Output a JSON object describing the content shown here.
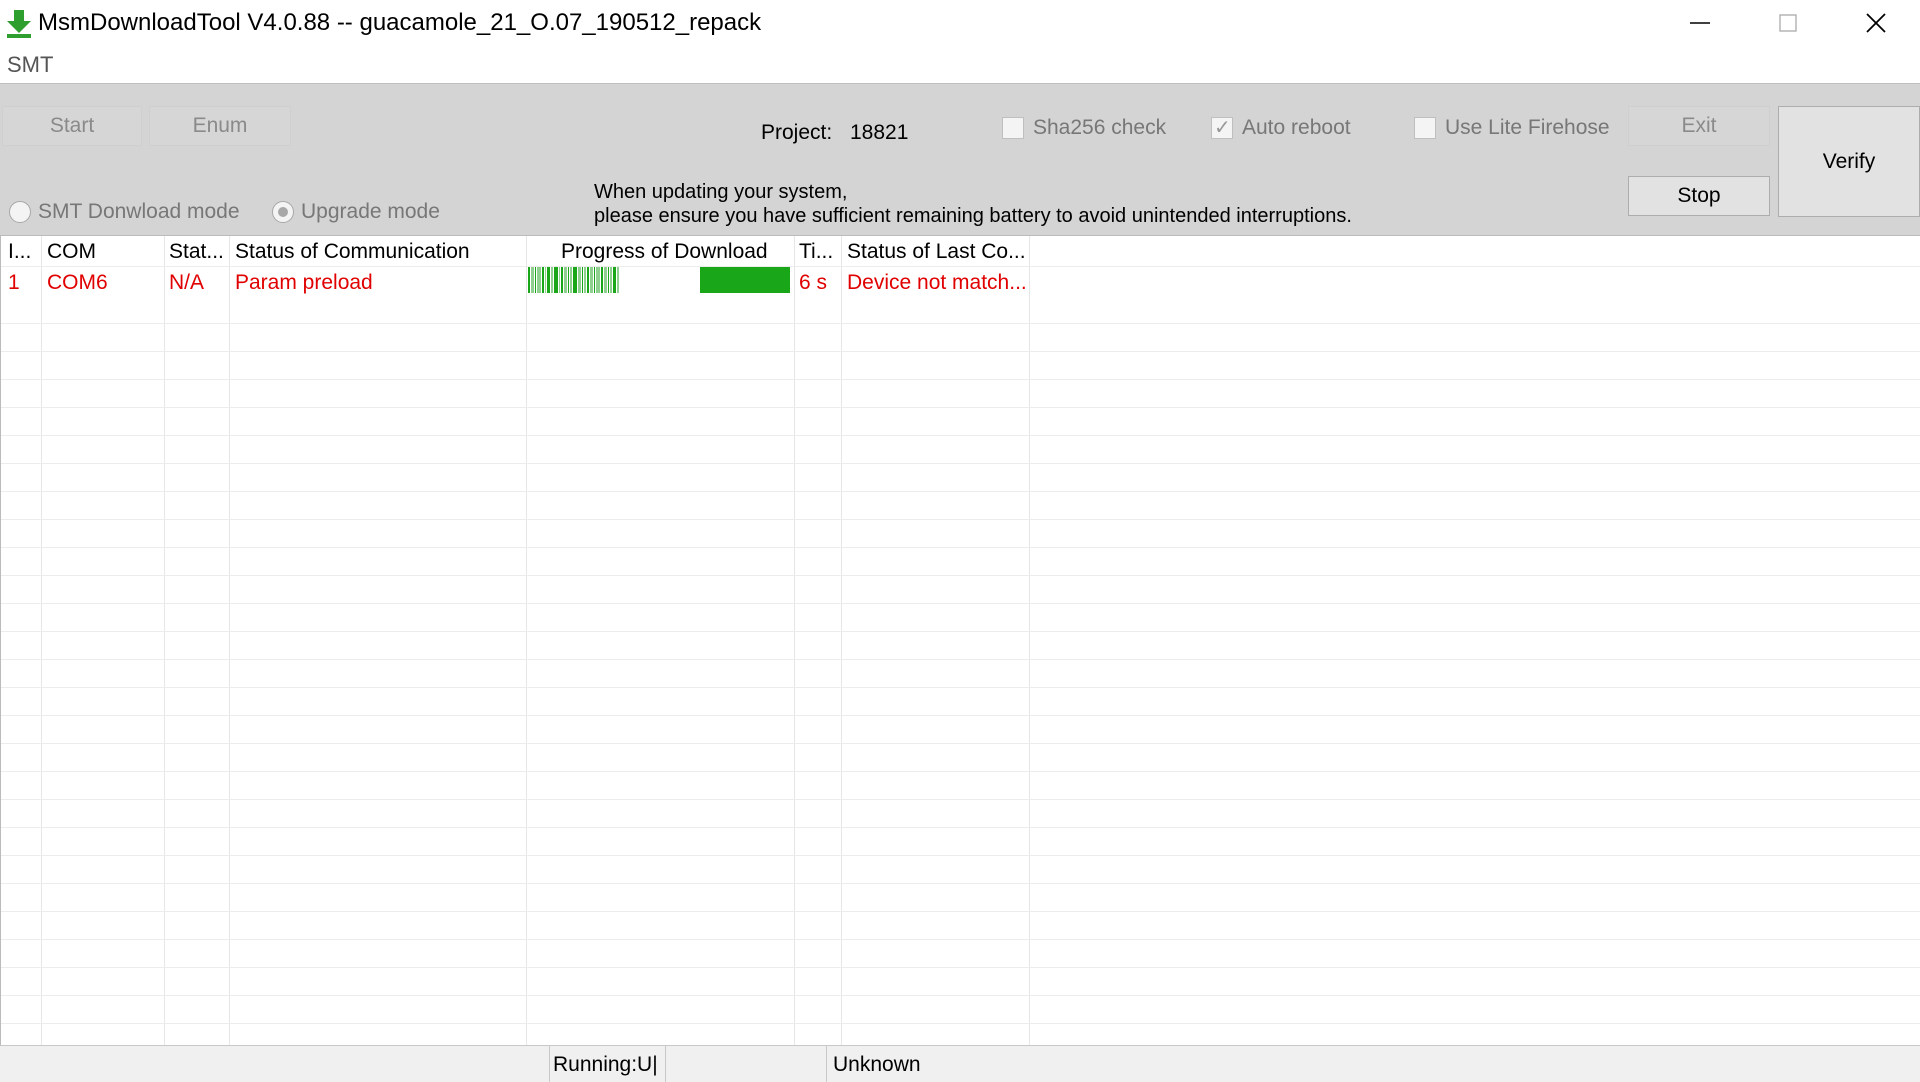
{
  "window": {
    "title": "MsmDownloadTool V4.0.88 -- guacamole_21_O.07_190512_repack",
    "accent": "#2e9f2e"
  },
  "menu": {
    "items": [
      "SMT"
    ]
  },
  "toolbar": {
    "start_label": "Start",
    "enum_label": "Enum",
    "project_label": "Project:",
    "project_value": "18821",
    "sha256_label": "Sha256 check",
    "sha256_checked": false,
    "auto_reboot_label": "Auto reboot",
    "auto_reboot_checked": true,
    "lite_firehose_label": "Use Lite Firehose",
    "lite_firehose_checked": false,
    "exit_label": "Exit",
    "stop_label": "Stop",
    "verify_label": "Verify",
    "smt_mode_label": "SMT Donwload mode",
    "upgrade_mode_label": "Upgrade mode",
    "selected_mode": "Upgrade mode",
    "notice_line1": "When updating your system,",
    "notice_line2": "please ensure you have sufficient remaining battery to avoid unintended interruptions."
  },
  "table": {
    "headers": [
      "I...",
      "COM",
      "Stat...",
      "Status of Communication",
      "Progress of Download",
      "Ti...",
      "Status of Last Co..."
    ],
    "rows": [
      {
        "index": "1",
        "com": "COM6",
        "stat": "N/A",
        "communication": "Param preload",
        "progress": 1.0,
        "time": "6 s",
        "last_status": "Device not match..."
      }
    ],
    "row_text_color": "#e00000",
    "progress_color": "#19a619"
  },
  "statusbar": {
    "running": "Running:U|",
    "state": "Unknown"
  }
}
